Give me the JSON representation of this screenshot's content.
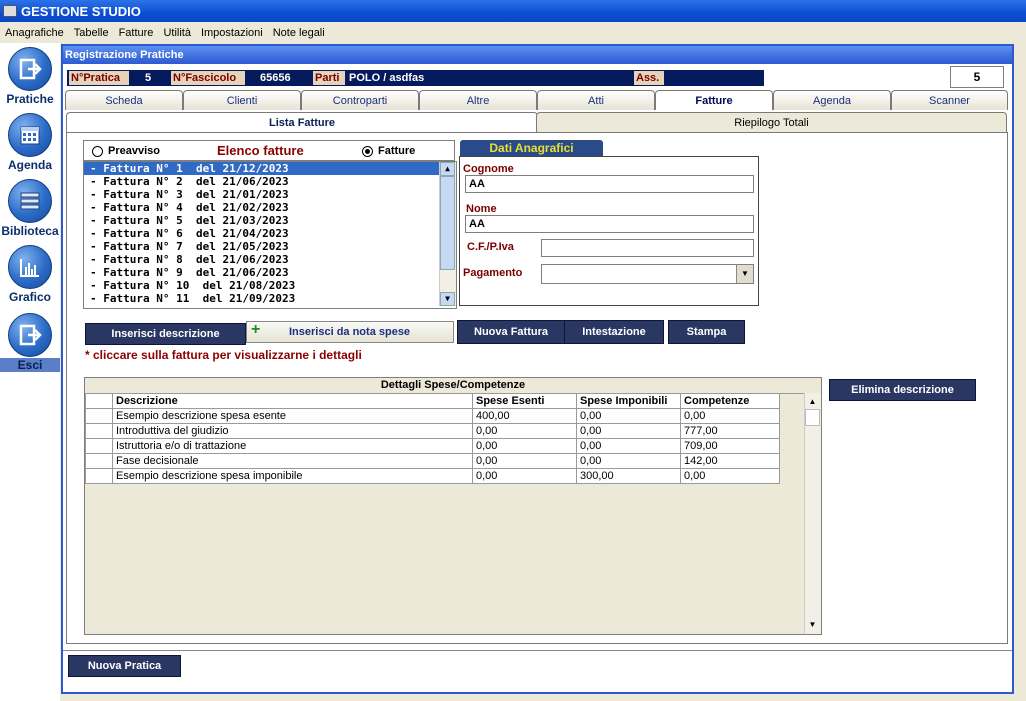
{
  "app": {
    "title": "GESTIONE STUDIO"
  },
  "menu": [
    "Anagrafiche",
    "Tabelle",
    "Fatture",
    "Utilità",
    "Impostazioni",
    "Note legali"
  ],
  "sidebar": {
    "items": [
      {
        "label": "Pratiche",
        "icon": "exit-icon"
      },
      {
        "label": "Agenda",
        "icon": "calendar-icon"
      },
      {
        "label": "Biblioteca",
        "icon": "books-icon"
      },
      {
        "label": "Grafico",
        "icon": "bar-chart-icon"
      },
      {
        "label": "Esci",
        "icon": "exit-icon"
      }
    ]
  },
  "window": {
    "title": "Registrazione Pratiche"
  },
  "header": {
    "pratica_label": "N°Pratica",
    "pratica_value": "5",
    "fascicolo_label": "N°Fascicolo",
    "fascicolo_value": "65656",
    "parti_label": "Parti",
    "parti_value": "POLO / asdfas",
    "ass_label": "Ass.",
    "counter": "5"
  },
  "tabs": [
    "Scheda",
    "Clienti",
    "Controparti",
    "Altre",
    "Atti",
    "Fatture",
    "Agenda",
    "Scanner"
  ],
  "active_tab": "Fatture",
  "subtabs": [
    "Lista Fatture",
    "Riepilogo Totali"
  ],
  "invoices": {
    "title": "Elenco fatture",
    "radio_preavviso": "Preavviso",
    "radio_fatture": "Fatture",
    "items": [
      "- Fattura N° 1  del 21/12/2023",
      "- Fattura N° 2  del 21/06/2023",
      "- Fattura N° 3  del 21/01/2023",
      "- Fattura N° 4  del 21/02/2023",
      "- Fattura N° 5  del 21/03/2023",
      "- Fattura N° 6  del 21/04/2023",
      "- Fattura N° 7  del 21/05/2023",
      "- Fattura N° 8  del 21/06/2023",
      "- Fattura N° 9  del 21/06/2023",
      "- Fattura N° 10  del 21/08/2023",
      "- Fattura N° 11  del 21/09/2023"
    ]
  },
  "anagrafica": {
    "tab_label": "Dati Anagrafici",
    "cognome_label": "Cognome",
    "cognome_value": "AA",
    "nome_label": "Nome",
    "nome_value": "AA",
    "cf_label": "C.F./P.Iva",
    "cf_value": "",
    "pagamento_label": "Pagamento",
    "pagamento_value": ""
  },
  "buttons": {
    "inserisci_descrizione": "Inserisci descrizione",
    "inserisci_nota": "Inserisci da nota spese",
    "nuova_fattura": "Nuova Fattura",
    "intestazione": "Intestazione",
    "stampa": "Stampa",
    "elimina": "Elimina descrizione",
    "nuova_pratica": "Nuova Pratica"
  },
  "hint": "* cliccare sulla fattura per visualizzarne i dettagli",
  "details": {
    "title": "Dettagli Spese/Competenze",
    "columns": [
      "Descrizione",
      "Spese Esenti",
      "Spese Imponibili",
      "Competenze"
    ],
    "rows": [
      [
        "Esempio descrizione spesa esente",
        "400,00",
        "0,00",
        "0,00"
      ],
      [
        "Introduttiva del giudizio",
        "0,00",
        "0,00",
        "777,00"
      ],
      [
        "Istruttoria e/o di trattazione",
        "0,00",
        "0,00",
        "709,00"
      ],
      [
        "Fase decisionale",
        "0,00",
        "0,00",
        "142,00"
      ],
      [
        "Esempio descrizione spesa imponibile",
        "0,00",
        "300,00",
        "0,00"
      ]
    ]
  }
}
